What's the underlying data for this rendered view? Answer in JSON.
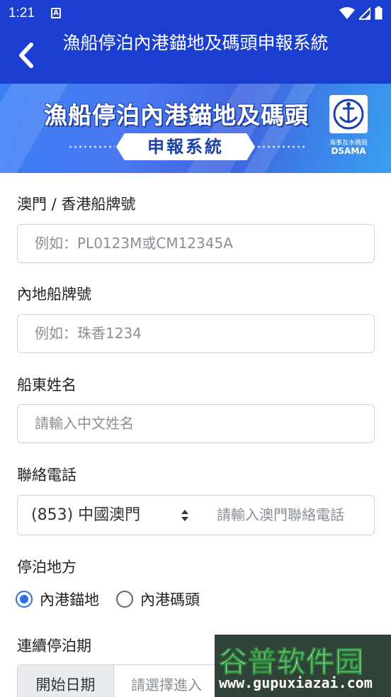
{
  "status_bar": {
    "time": "1:21",
    "notification_icon": "a-badge-icon",
    "icons": [
      "wifi-icon",
      "signal-icon",
      "battery-icon"
    ]
  },
  "app_bar": {
    "title": "漁船停泊內港錨地及碼頭申報系統",
    "back_icon": "chevron-left-icon",
    "background_color": "#1a3ecf"
  },
  "banner": {
    "title": "漁船停泊內港錨地及碼頭",
    "subtitle": "申報系統",
    "logo_cn": "海事及水務局",
    "logo_en": "DSAMA"
  },
  "form": {
    "plate_macau_hk": {
      "label": "澳門 / 香港船牌號",
      "placeholder": "例如：PL0123M或CM12345A"
    },
    "plate_mainland": {
      "label": "內地船牌號",
      "placeholder": "例如：珠香1234"
    },
    "owner_name": {
      "label": "船東姓名",
      "placeholder": "請輸入中文姓名"
    },
    "phone": {
      "label": "聯絡電話",
      "region_selected": "(853) 中國澳門",
      "placeholder": "請輸入澳門聯絡電話"
    },
    "berth": {
      "label": "停泊地方",
      "options": [
        {
          "label": "內港錨地",
          "checked": true
        },
        {
          "label": "內港碼頭",
          "checked": false
        }
      ]
    },
    "period": {
      "label": "連續停泊期",
      "start_addon": "開始日期",
      "start_placeholder": "請選擇進入"
    }
  },
  "watermark": {
    "name": "谷普软件园",
    "url": "www.gupuxiazai.com"
  },
  "colors": {
    "primary": "#1a3ecf",
    "radio_accent": "#2a6ff0"
  }
}
